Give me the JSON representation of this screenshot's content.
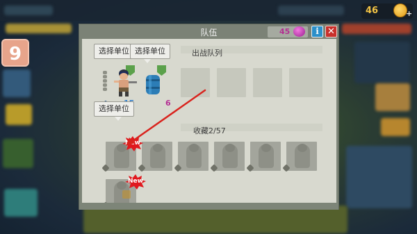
{
  "hud": {
    "level": "9",
    "gold_amount": "46",
    "gold_icon": "gold-coin-icon",
    "add_gold": "+"
  },
  "dialog": {
    "title": "队伍",
    "gem_amount": "45",
    "gem_icon": "purple-gem-icon",
    "info_label": "i",
    "close_label": "✕",
    "tooltips": [
      "选择单位",
      "选择单位",
      "选择单位"
    ],
    "deploy_label": "出战队列",
    "collection_label": "收藏2/57",
    "deployed_units": [
      {
        "name": "soldier-unit",
        "level": "15",
        "level_color": "#2f7fd1"
      },
      {
        "name": "barrel-unit",
        "level": "6",
        "level_color": "#b42f94"
      }
    ],
    "collection_units": [
      {
        "name": "locked-unit",
        "badge": "New"
      },
      {
        "name": "locked-unit"
      },
      {
        "name": "locked-unit"
      },
      {
        "name": "locked-unit"
      },
      {
        "name": "locked-unit"
      },
      {
        "name": "locked-unit"
      },
      {
        "name": "locked-unit",
        "badge": "New"
      }
    ]
  },
  "colors": {
    "accent_close": "#c8302b",
    "accent_info": "#2b8fc9",
    "new_badge": "#e0181e",
    "arrow": "#d9231d"
  }
}
